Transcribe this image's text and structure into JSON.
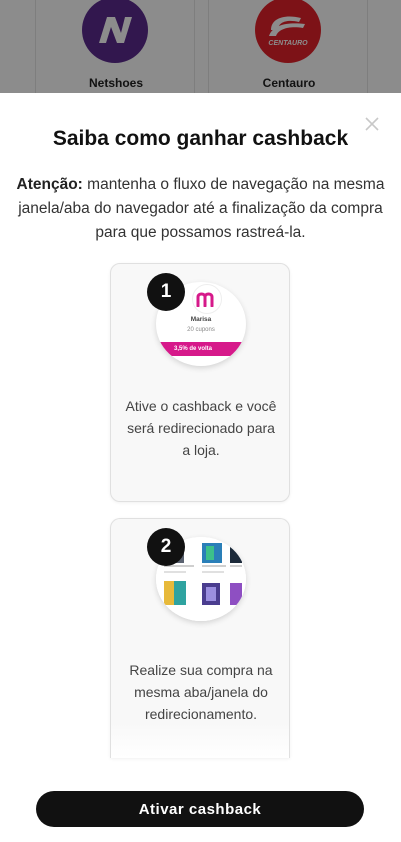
{
  "background": {
    "stores": [
      {
        "name": "Netshoes",
        "logo": "netshoes-logo"
      },
      {
        "name": "Centauro",
        "logo": "centauro-logo",
        "logo_text": "CENTAURO"
      }
    ]
  },
  "modal": {
    "title": "Saiba como ganhar cashback",
    "intro_bold": "Atenção:",
    "intro_text": " mantenha o fluxo de navegação na mesma janela/aba do navegador até a finalização da compra para que possamos rastreá-la.",
    "close_icon": "close-icon",
    "steps": [
      {
        "number": "1",
        "illustration": {
          "store": "Marisa",
          "coupons": "20 cupons",
          "cashback": "3,5% de volta"
        },
        "text": "Ative o cashback e você será redirecionado para a loja."
      },
      {
        "number": "2",
        "illustration": {},
        "text": "Realize sua compra na mesma aba/janela do redirecionamento."
      }
    ],
    "cta_label": "Ativar cashback"
  },
  "colors": {
    "overlay": "#000000",
    "brand_pink": "#d6198a",
    "netshoes_purple": "#5b2a8e",
    "centauro_red": "#e4222a",
    "button": "#111111"
  }
}
